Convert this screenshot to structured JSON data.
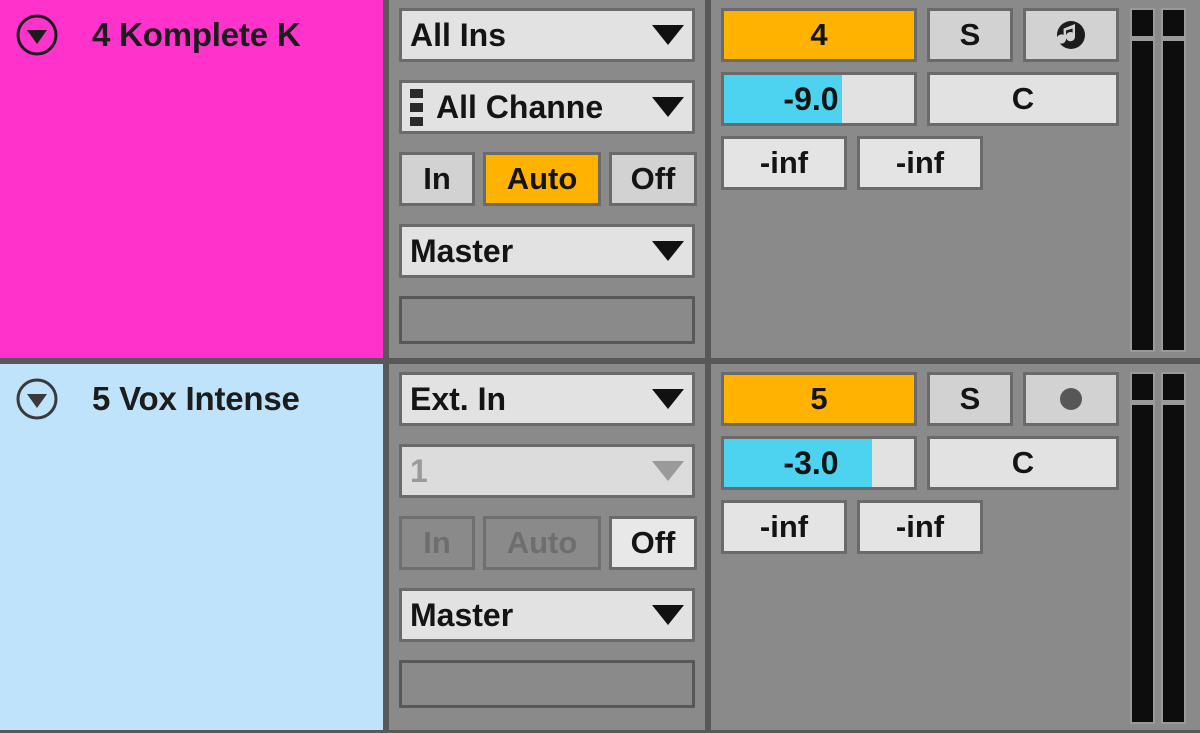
{
  "app": {
    "view_name": "session-mixer",
    "colors": {
      "panel_bg": "#8a8a8a",
      "divider": "#585858",
      "activator_on": "#FFB300",
      "volume_fill": "#4DD2F0",
      "field_bg": "#e2e2e2"
    }
  },
  "tracks": [
    {
      "id": "track-4",
      "fold_icon": "triangle-down-circle-icon",
      "title": "4 Komplete K",
      "color": "#FF33CC",
      "io": {
        "input_type": {
          "label": "All Ins",
          "icon": "chevron-down-icon",
          "state": "enabled"
        },
        "input_channel": {
          "label": "All Channe",
          "icon": "midi-dots-icon",
          "state": "enabled"
        },
        "monitor": {
          "in_label": "In",
          "auto_label": "Auto",
          "off_label": "Off",
          "selected": "Auto"
        },
        "output_type": {
          "label": "Master",
          "icon": "chevron-down-icon",
          "state": "enabled"
        },
        "output_channel": {
          "label": "",
          "state": "empty"
        }
      },
      "mixer": {
        "activator_label": "4",
        "activator_state": "on",
        "solo_label": "S",
        "solo_state": "off",
        "arm_icon": "midi-arm-note-icon",
        "arm_state": "off",
        "volume_label": "-9.0",
        "volume_fill_percent": 62,
        "pan_label": "C",
        "sends": [
          "-inf",
          "-inf"
        ],
        "meter_count": 2
      }
    },
    {
      "id": "track-5",
      "fold_icon": "triangle-down-circle-icon",
      "title": "5 Vox Intense",
      "color": "#BFE3FB",
      "io": {
        "input_type": {
          "label": "Ext. In",
          "icon": "chevron-down-icon",
          "state": "enabled"
        },
        "input_channel": {
          "label": "1",
          "icon": "chevron-down-icon",
          "state": "dimmed"
        },
        "monitor": {
          "in_label": "In",
          "auto_label": "Auto",
          "off_label": "Off",
          "selected": "Off"
        },
        "output_type": {
          "label": "Master",
          "icon": "chevron-down-icon",
          "state": "enabled"
        },
        "output_channel": {
          "label": "",
          "state": "empty"
        }
      },
      "mixer": {
        "activator_label": "5",
        "activator_state": "on",
        "solo_label": "S",
        "solo_state": "off",
        "arm_icon": "record-arm-circle-icon",
        "arm_state": "off",
        "volume_label": "-3.0",
        "volume_fill_percent": 78,
        "pan_label": "C",
        "sends": [
          "-inf",
          "-inf"
        ],
        "meter_count": 2
      }
    }
  ]
}
